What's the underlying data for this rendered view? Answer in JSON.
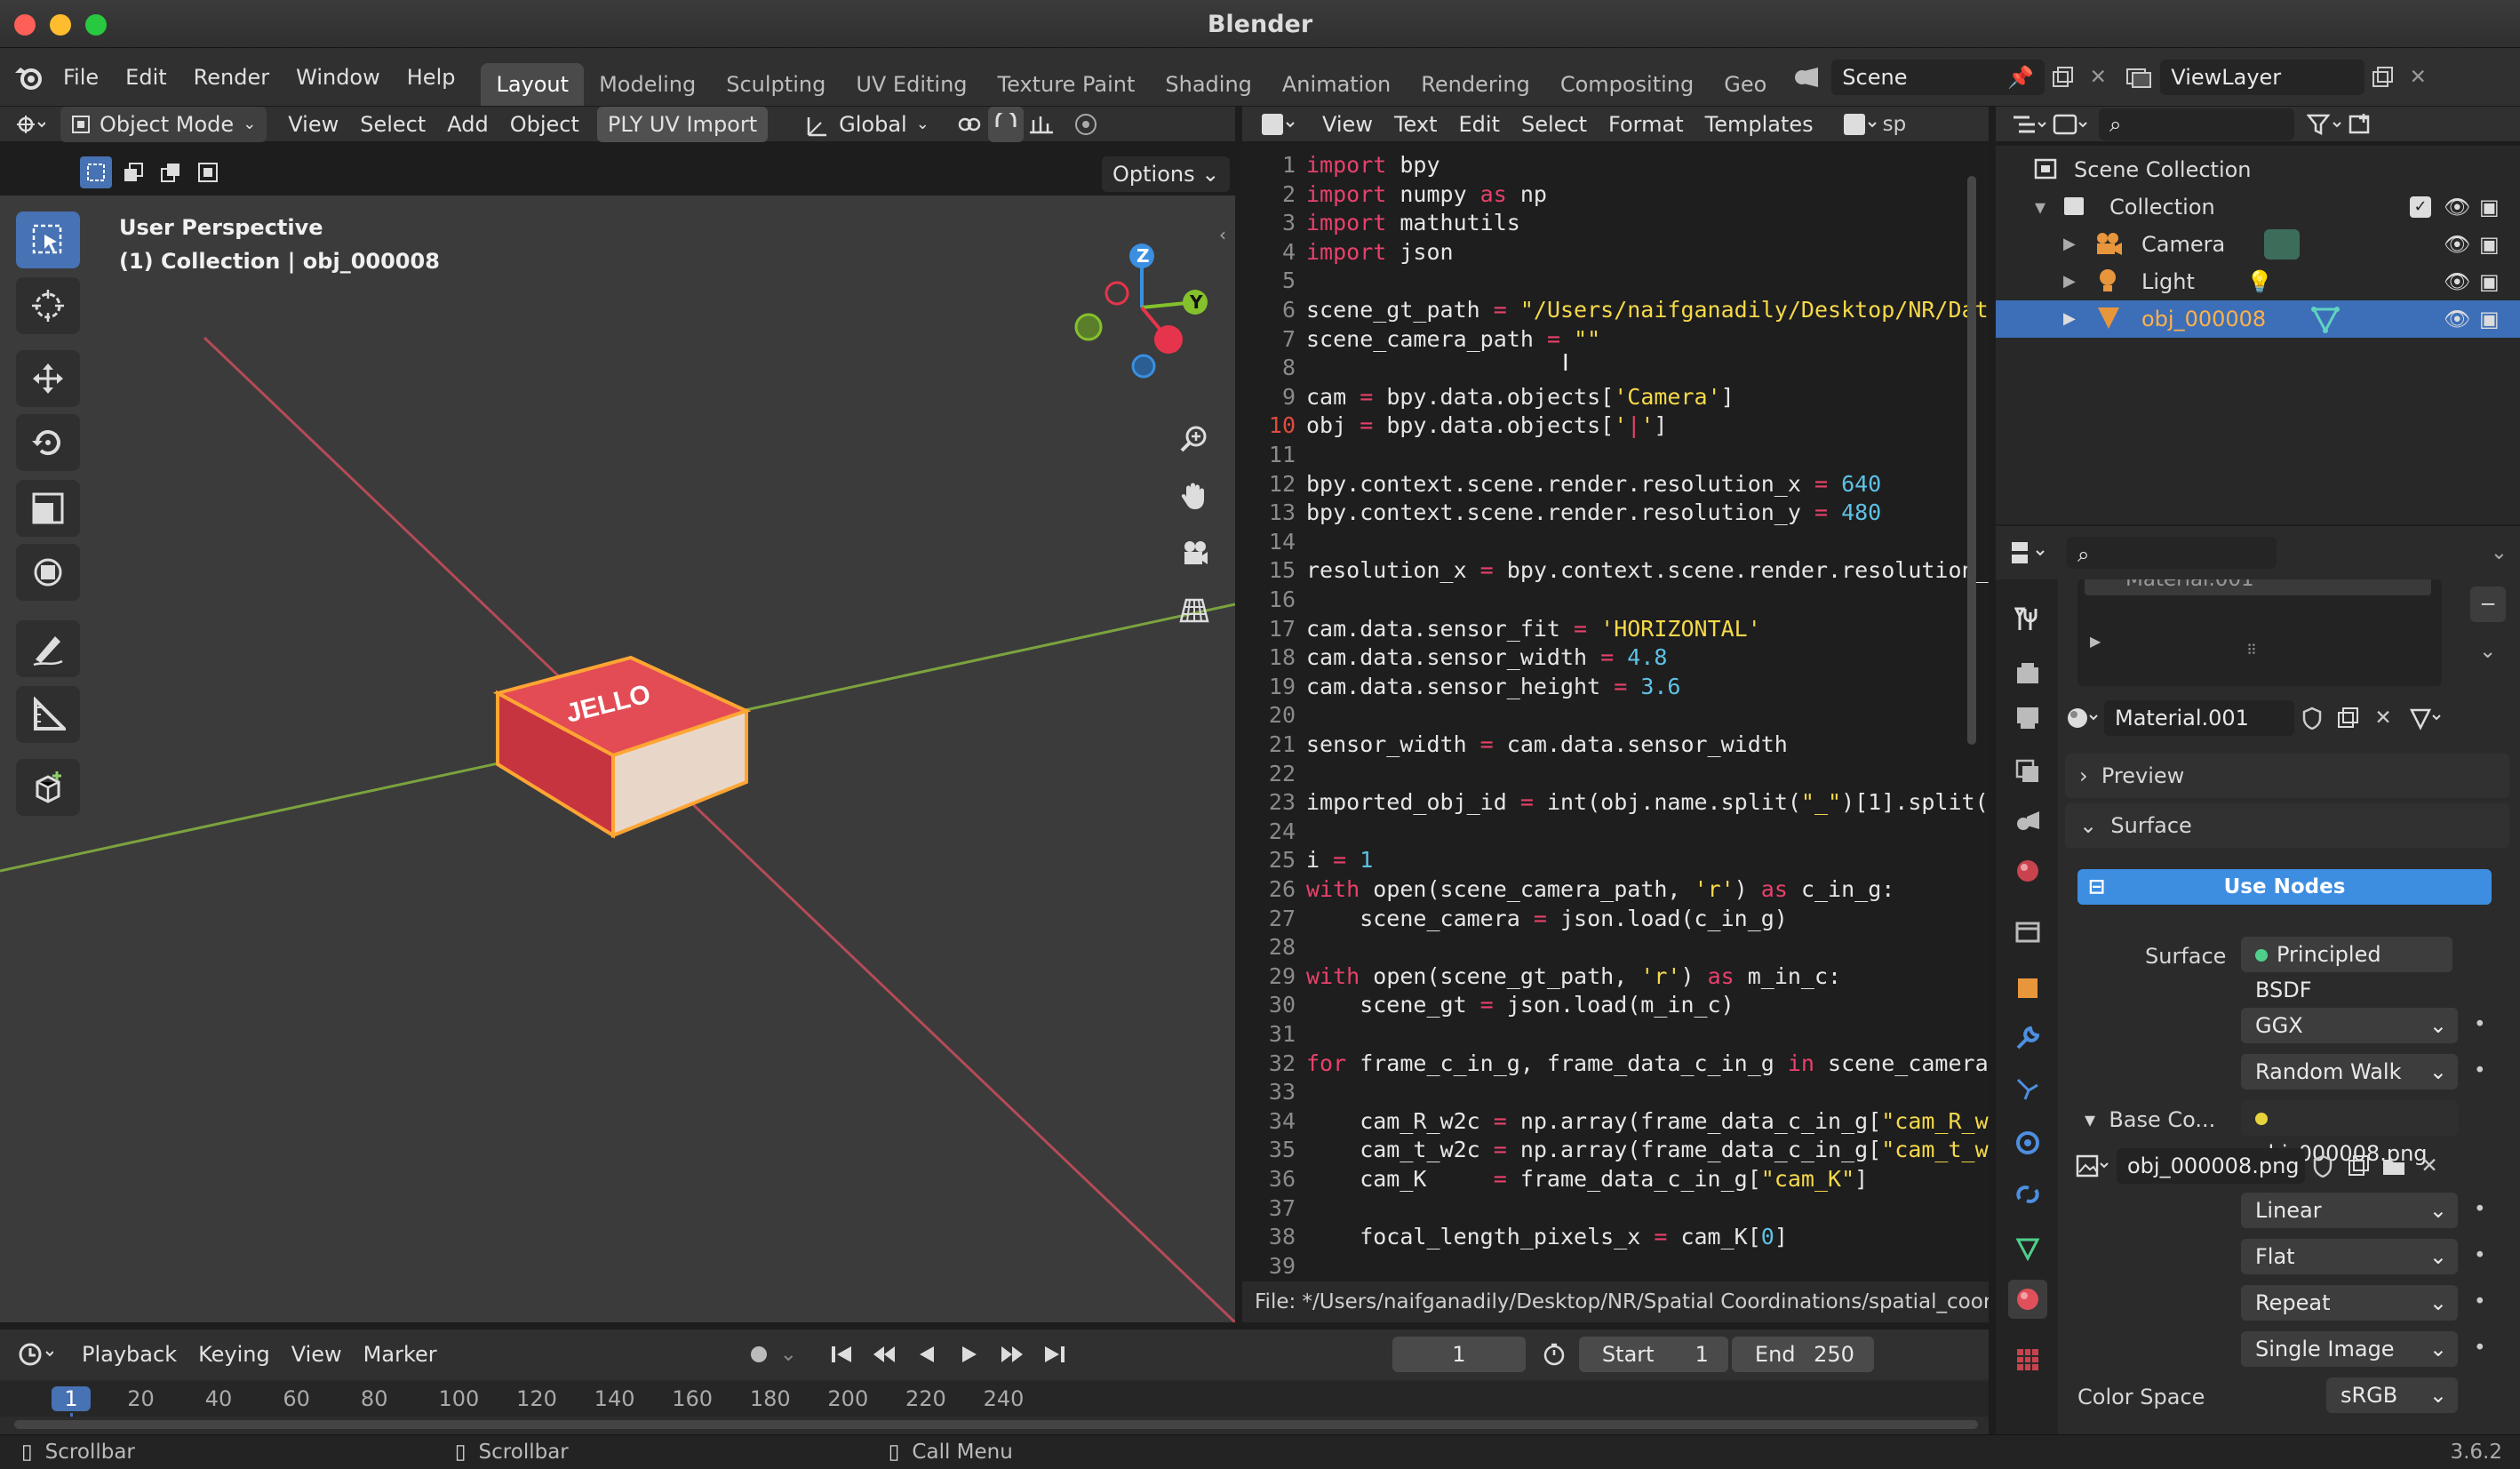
{
  "window": {
    "title": "Blender",
    "version": "3.6.2"
  },
  "menu": [
    "File",
    "Edit",
    "Render",
    "Window",
    "Help"
  ],
  "workspaces": [
    "Layout",
    "Modeling",
    "Sculpting",
    "UV Editing",
    "Texture Paint",
    "Shading",
    "Animation",
    "Rendering",
    "Compositing",
    "Geo"
  ],
  "scene": {
    "name": "Scene",
    "view_layer": "ViewLayer"
  },
  "viewport": {
    "mode": "Object Mode",
    "menus": [
      "View",
      "Select",
      "Add",
      "Object"
    ],
    "addon_button": "PLY UV Import",
    "orientation": "Global",
    "options": "Options",
    "overlay_title": "User Perspective",
    "overlay_sub": "(1) Collection | obj_000008",
    "object_label": "JELLO"
  },
  "text_editor": {
    "menus": [
      "View",
      "Text",
      "Edit",
      "Select",
      "Format",
      "Templates"
    ],
    "filepath": "File: */Users/naifganadily/Desktop/NR/Spatial Coordinations/spatial_coordi",
    "current_line": 10,
    "lines": [
      [
        [
          "kw",
          "import"
        ],
        [
          "tx",
          " bpy"
        ]
      ],
      [
        [
          "kw",
          "import"
        ],
        [
          "tx",
          " numpy "
        ],
        [
          "kw",
          "as"
        ],
        [
          "tx",
          " np"
        ]
      ],
      [
        [
          "kw",
          "import"
        ],
        [
          "tx",
          " mathutils"
        ]
      ],
      [
        [
          "kw",
          "import"
        ],
        [
          "tx",
          " json"
        ]
      ],
      [],
      [
        [
          "tx",
          "scene_gt_path "
        ],
        [
          "op",
          "="
        ],
        [
          "tx",
          " "
        ],
        [
          "st",
          "\"/Users/naifganadily/Desktop/NR/Dat"
        ]
      ],
      [
        [
          "tx",
          "scene_camera_path "
        ],
        [
          "op",
          "="
        ],
        [
          "tx",
          " "
        ],
        [
          "st",
          "\"\""
        ]
      ],
      [],
      [
        [
          "tx",
          "cam "
        ],
        [
          "op",
          "="
        ],
        [
          "tx",
          " bpy.data.objects["
        ],
        [
          "st",
          "'Camera'"
        ],
        [
          "tx",
          "]"
        ]
      ],
      [
        [
          "tx",
          "obj "
        ],
        [
          "op",
          "="
        ],
        [
          "tx",
          " bpy.data.objects["
        ],
        [
          "st",
          "'"
        ],
        [
          "kw",
          "|"
        ],
        [
          "st",
          "'"
        ],
        [
          "tx",
          "]"
        ]
      ],
      [],
      [
        [
          "tx",
          "bpy.context.scene.render.resolution_x "
        ],
        [
          "op",
          "="
        ],
        [
          "tx",
          " "
        ],
        [
          "nu",
          "640"
        ]
      ],
      [
        [
          "tx",
          "bpy.context.scene.render.resolution_y "
        ],
        [
          "op",
          "="
        ],
        [
          "tx",
          " "
        ],
        [
          "nu",
          "480"
        ]
      ],
      [],
      [
        [
          "tx",
          "resolution_x "
        ],
        [
          "op",
          "="
        ],
        [
          "tx",
          " bpy.context.scene.render.resolution_"
        ]
      ],
      [],
      [
        [
          "tx",
          "cam.data.sensor_fit "
        ],
        [
          "op",
          "="
        ],
        [
          "tx",
          " "
        ],
        [
          "st",
          "'HORIZONTAL'"
        ]
      ],
      [
        [
          "tx",
          "cam.data.sensor_width "
        ],
        [
          "op",
          "="
        ],
        [
          "tx",
          " "
        ],
        [
          "nu",
          "4.8"
        ]
      ],
      [
        [
          "tx",
          "cam.data.sensor_height "
        ],
        [
          "op",
          "="
        ],
        [
          "tx",
          " "
        ],
        [
          "nu",
          "3.6"
        ]
      ],
      [],
      [
        [
          "tx",
          "sensor_width "
        ],
        [
          "op",
          "="
        ],
        [
          "tx",
          " cam.data.sensor_width"
        ]
      ],
      [],
      [
        [
          "tx",
          "imported_obj_id "
        ],
        [
          "op",
          "="
        ],
        [
          "tx",
          " int(obj.name.split("
        ],
        [
          "st",
          "\"_\""
        ],
        [
          "tx",
          ")[1].split("
        ]
      ],
      [],
      [
        [
          "tx",
          "i "
        ],
        [
          "op",
          "="
        ],
        [
          "tx",
          " "
        ],
        [
          "nu",
          "1"
        ]
      ],
      [
        [
          "kw",
          "with"
        ],
        [
          "tx",
          " open(scene_camera_path, "
        ],
        [
          "st",
          "'r'"
        ],
        [
          "tx",
          ") "
        ],
        [
          "kw",
          "as"
        ],
        [
          "tx",
          " c_in_g:"
        ]
      ],
      [
        [
          "tx",
          "    scene_camera "
        ],
        [
          "op",
          "="
        ],
        [
          "tx",
          " json.load(c_in_g)"
        ]
      ],
      [],
      [
        [
          "kw",
          "with"
        ],
        [
          "tx",
          " open(scene_gt_path, "
        ],
        [
          "st",
          "'r'"
        ],
        [
          "tx",
          ") "
        ],
        [
          "kw",
          "as"
        ],
        [
          "tx",
          " m_in_c:"
        ]
      ],
      [
        [
          "tx",
          "    scene_gt "
        ],
        [
          "op",
          "="
        ],
        [
          "tx",
          " json.load(m_in_c)"
        ]
      ],
      [],
      [
        [
          "kw",
          "for"
        ],
        [
          "tx",
          " frame_c_in_g, frame_data_c_in_g "
        ],
        [
          "kw",
          "in"
        ],
        [
          "tx",
          " scene_camera"
        ]
      ],
      [],
      [
        [
          "tx",
          "    cam_R_w2c "
        ],
        [
          "op",
          "="
        ],
        [
          "tx",
          " np.array(frame_data_c_in_g["
        ],
        [
          "st",
          "\"cam_R_w"
        ]
      ],
      [
        [
          "tx",
          "    cam_t_w2c "
        ],
        [
          "op",
          "="
        ],
        [
          "tx",
          " np.array(frame_data_c_in_g["
        ],
        [
          "st",
          "\"cam_t_w"
        ]
      ],
      [
        [
          "tx",
          "    cam_K     "
        ],
        [
          "op",
          "="
        ],
        [
          "tx",
          " frame_data_c_in_g["
        ],
        [
          "st",
          "\"cam_K\""
        ],
        [
          "tx",
          "]"
        ]
      ],
      [],
      [
        [
          "tx",
          "    focal_length_pixels_x "
        ],
        [
          "op",
          "="
        ],
        [
          "tx",
          " cam_K["
        ],
        [
          "nu",
          "0"
        ],
        [
          "tx",
          "]"
        ]
      ],
      []
    ]
  },
  "outliner": {
    "root": "Scene Collection",
    "collection": "Collection",
    "items": [
      "Camera",
      "Light",
      "obj_000008"
    ],
    "selected": "obj_000008"
  },
  "properties": {
    "material_list_partial": "Material.001",
    "material": "Material.001",
    "preview": "Preview",
    "surface_header": "Surface",
    "use_nodes": "Use Nodes",
    "surface_label": "Surface",
    "surface_value": "Principled BSDF",
    "distribution": "GGX",
    "subsurface": "Random Walk",
    "base_color_label": "Base Co...",
    "base_color_value": "obj_000008.png",
    "image": "obj_000008.png",
    "interpolation": "Linear",
    "projection": "Flat",
    "extension": "Repeat",
    "source": "Single Image",
    "color_space_label": "Color Space",
    "color_space": "sRGB"
  },
  "timeline": {
    "menus": [
      "Playback",
      "Keying",
      "View",
      "Marker"
    ],
    "current_frame": "1",
    "start_label": "Start",
    "start": "1",
    "end_label": "End",
    "end": "250",
    "ticks": [
      "1",
      "20",
      "40",
      "60",
      "80",
      "100",
      "120",
      "140",
      "160",
      "180",
      "200",
      "220",
      "240"
    ]
  },
  "statusbar": [
    "Scrollbar",
    "Scrollbar",
    "Call Menu"
  ],
  "colors": {
    "accent": "#4772b3",
    "selected_row": "#3d6fb8",
    "use_nodes": "#3d8ee0",
    "x_axis": "#b44b57",
    "y_axis": "#7ba33e"
  }
}
